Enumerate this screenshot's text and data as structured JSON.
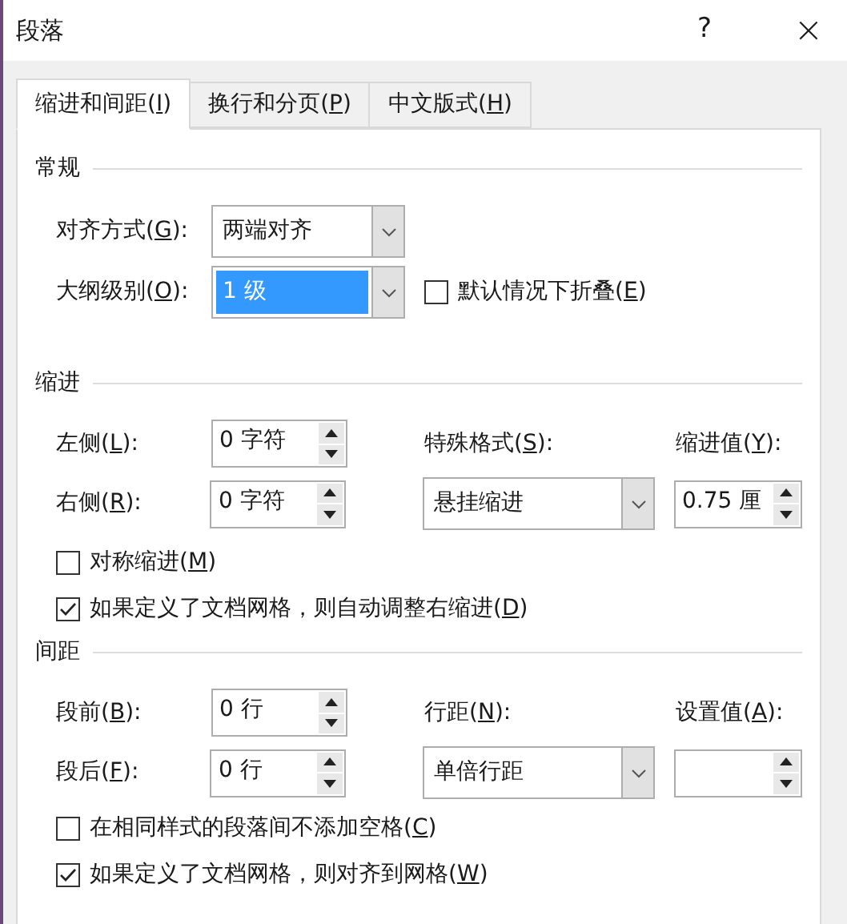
{
  "window": {
    "title": "段落",
    "help": "?",
    "close": "×"
  },
  "tabs": [
    {
      "label": "缩进和间距(I)",
      "selected": true
    },
    {
      "label": "换行和分页(P)",
      "selected": false
    },
    {
      "label": "中文版式(H)",
      "selected": false
    }
  ],
  "general": {
    "heading": "常规",
    "alignment": {
      "label": "对齐方式(G):",
      "value": "两端对齐",
      "selected": false
    },
    "outline_level": {
      "label": "大纲级别(O):",
      "value": "1 级",
      "selected": true
    },
    "collapse": {
      "label": "默认情况下折叠(E)",
      "checked": false
    }
  },
  "indentation": {
    "heading": "缩进",
    "left": {
      "label": "左侧(L):",
      "value": "0 字符"
    },
    "right": {
      "label": "右侧(R):",
      "value": "0 字符"
    },
    "special": {
      "label": "特殊格式(S):",
      "value": "悬挂缩进",
      "selected": false
    },
    "by": {
      "label": "缩进值(Y):",
      "value": "0.75 厘"
    },
    "checkboxes": [
      {
        "label": "对称缩进(M)",
        "checked": false
      },
      {
        "label": "如果定义了文档网格，则自动调整右缩进(D)",
        "checked": true
      }
    ]
  },
  "spacing": {
    "heading": "间距",
    "before": {
      "label": "段前(B):",
      "value": "0 行"
    },
    "after": {
      "label": "段后(F):",
      "value": "0 行"
    },
    "line_spacing": {
      "label": "行距(N):",
      "value": "单倍行距",
      "selected": false
    },
    "at": {
      "label": "设置值(A):"
    },
    "checkboxes": [
      {
        "label": "在相同样式的段落间不添加空格(C)",
        "checked": false
      },
      {
        "label": "如果定义了文档网格，则对齐到网格(W)",
        "checked": true
      }
    ]
  }
}
